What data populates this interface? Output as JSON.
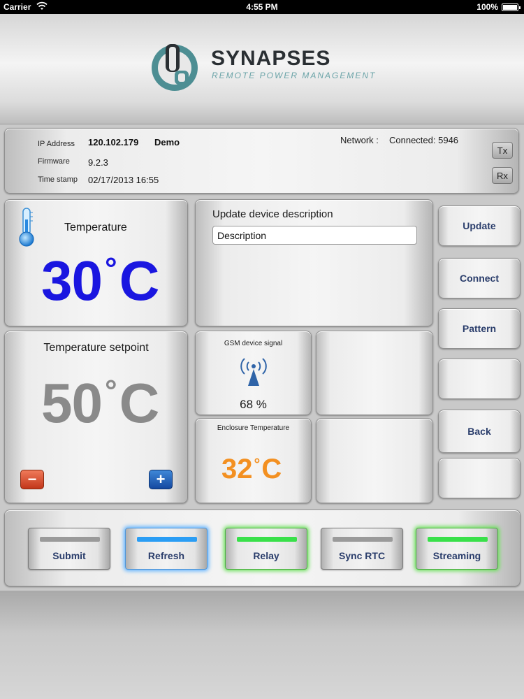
{
  "statusbar": {
    "carrier": "Carrier",
    "time": "4:55 PM",
    "battery": "100%"
  },
  "logo": {
    "title": "SYNAPSES",
    "subtitle": "REMOTE POWER MANAGEMENT"
  },
  "info": {
    "ip_label": "IP Address",
    "ip_value": "120.102.179",
    "device_name": "Demo",
    "firmware_label": "Firmware",
    "firmware_value": "9.2.3",
    "timestamp_label": "Time stamp",
    "timestamp_value": "02/17/2013 16:55",
    "network_label": "Network :",
    "network_value": "Connected: 5946",
    "tx": "Tx",
    "rx": "Rx"
  },
  "temperature": {
    "label": "Temperature",
    "value": "30",
    "unit": "C",
    "degree": "°",
    "color": "#1a16e0"
  },
  "setpoint": {
    "label": "Temperature setpoint",
    "value": "50",
    "unit": "C",
    "degree": "°",
    "minus": "−",
    "plus": "+"
  },
  "description": {
    "label": "Update device description",
    "placeholder": "Description"
  },
  "gsm": {
    "label": "GSM device signal",
    "value": "68 %",
    "icon": "signal-tower-icon"
  },
  "enclosure": {
    "label": "Enclosure Temperature",
    "value": "32",
    "unit": "C",
    "degree": "°",
    "color": "#f39021"
  },
  "side_buttons": [
    "Update",
    "Connect",
    "Pattern",
    "",
    "Back",
    ""
  ],
  "toolbar": {
    "buttons": [
      {
        "label": "Submit",
        "state": "off"
      },
      {
        "label": "Refresh",
        "state": "blue"
      },
      {
        "label": "Relay",
        "state": "green"
      },
      {
        "label": "Sync RTC",
        "state": "off"
      },
      {
        "label": "Streaming",
        "state": "green"
      }
    ]
  }
}
